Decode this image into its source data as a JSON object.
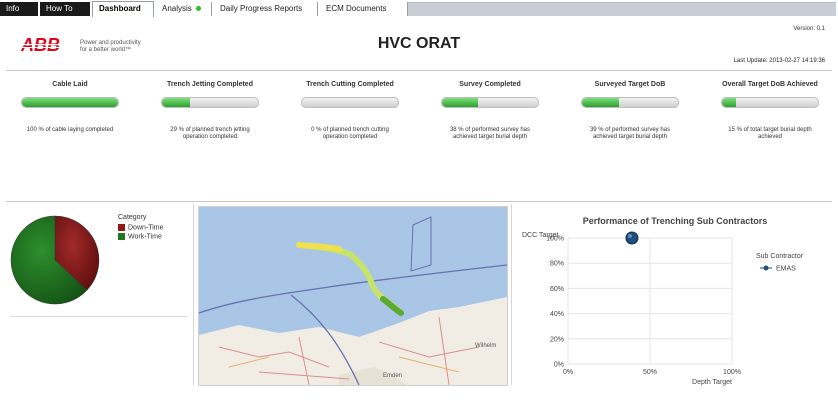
{
  "tabs": [
    {
      "label": "Info"
    },
    {
      "label": "How To"
    },
    {
      "label": "Dashboard"
    },
    {
      "label": "Analysis"
    },
    {
      "label": "Daily Progress Reports"
    },
    {
      "label": "ECM Documents"
    }
  ],
  "header": {
    "version": "Version: 0.1",
    "logo_text": "ABB",
    "slogan_line1": "Power and productivity",
    "slogan_line2": "for a better world™",
    "title": "HVC ORAT",
    "last_update": "Last Update: 2013-02-27 14:19:36"
  },
  "kpis": [
    {
      "label": "Cable Laid",
      "progress_pct": 100,
      "desc": "100 % of cable laying completed"
    },
    {
      "label": "Trench Jetting Completed",
      "progress_pct": 29,
      "desc": "29 % of planned trench jetting operation completed"
    },
    {
      "label": "Trench Cutting Completed",
      "progress_pct": 0,
      "desc": "0 % of planned trench cutting operation completed"
    },
    {
      "label": "Survey Completed",
      "progress_pct": 38,
      "desc": "38 % of performed survey has achieved target burial depth"
    },
    {
      "label": "Surveyed Target DoB",
      "progress_pct": 39,
      "desc": "39 % of performed survey has achieved target burial depth"
    },
    {
      "label": "Overall Target DoB Achieved",
      "progress_pct": 15,
      "desc": "15 % of total target burial depth achieved"
    }
  ],
  "colors": {
    "downtime": "#8b1a1a",
    "worktime": "#1f7a1f",
    "progress": "#3cb33c",
    "marker": "#1d4f7a",
    "sea": "#a9c6e6",
    "land": "#f1ede4"
  },
  "pie": {
    "legend_title": "Category",
    "slices": [
      {
        "label": "Down-Time",
        "value": 37
      },
      {
        "label": "Work-Time",
        "value": 63
      }
    ]
  },
  "map": {
    "label_1": "Wilhelm",
    "label_2": "Emden"
  },
  "chart_data": {
    "type": "scatter",
    "title": "Performance of Trenching Sub Contractors",
    "ylabel": "DCC Target",
    "xlabel": "Depth Target",
    "x_ticks": [
      "0%",
      "50%",
      "100%"
    ],
    "y_ticks": [
      "0%",
      "20%",
      "40%",
      "60%",
      "80%",
      "100%"
    ],
    "xlim": [
      0,
      100
    ],
    "ylim": [
      0,
      100
    ],
    "legend_title": "Sub Contractor",
    "series": [
      {
        "name": "EMAS",
        "points": [
          {
            "x": 39,
            "y": 100
          }
        ]
      }
    ]
  }
}
